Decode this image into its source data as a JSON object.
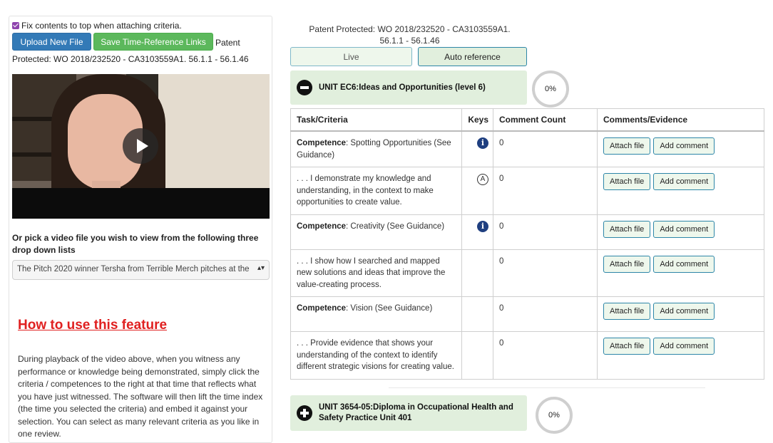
{
  "left": {
    "fix_label": "Fix contents to top when attaching criteria.",
    "upload_label": "Upload New File",
    "save_links_label": "Save Time-Reference Links",
    "patent_inline": "Patent",
    "patent_line2": "Protected: WO 2018/232520 - CA3103559A1. 56.1.1 - 56.1.46",
    "pick_label": "Or pick a video file you wish to view from the following three drop down lists",
    "select_value": "The Pitch 2020 winner Tersha from Terrible Merch pitches at the",
    "how_heading": "How to use this feature",
    "instructions": "During playback of the video above, when you witness any performance or knowledge being demonstrated, simply click the criteria / competences to the right at that time that reflects what you have just witnessed. The software will then lift the time index (the time you selected the criteria) and embed it against your selection. You can select as many relevant criteria as you like in one review."
  },
  "right": {
    "patent_top_line1": "Patent Protected: WO 2018/232520 - CA3103559A1.",
    "patent_top_line2": "56.1.1 - 56.1.46",
    "live_label": "Live",
    "auto_label": "Auto reference",
    "unit1": {
      "title": "UNIT EC6:Ideas and Opportunities (level 6)",
      "progress": "0%"
    },
    "unit2": {
      "title_line1": "UNIT 3654-05:Diploma in Occupational Health and",
      "title_line2": "Safety Practice Unit 401",
      "progress": "0%"
    },
    "table": {
      "headers": {
        "task": "Task/Criteria",
        "keys": "Keys",
        "count": "Comment Count",
        "comments": "Comments/Evidence"
      },
      "attach_label": "Attach file",
      "comment_label": "Add comment",
      "rows": [
        {
          "label": "Competence",
          "text": ": Spotting Opportunities (See Guidance)",
          "key": "i",
          "count": "0"
        },
        {
          "label": "",
          "text": ". . . I demonstrate my knowledge and understanding, in the context to make opportunities to create value.",
          "key": "A",
          "count": "0"
        },
        {
          "label": "Competence",
          "text": ": Creativity (See Guidance)",
          "key": "i",
          "count": "0"
        },
        {
          "label": "",
          "text": ". . . I show how I searched and mapped new solutions and ideas that improve the value-creating process.",
          "key": "",
          "count": "0"
        },
        {
          "label": "Competence",
          "text": ": Vision (See Guidance)",
          "key": "",
          "count": "0"
        },
        {
          "label": "",
          "text": ". . . Provide evidence that shows your understanding of the context to identify different strategic visions for creating value.",
          "key": "",
          "count": "0"
        }
      ]
    }
  },
  "colors": {
    "primary": "#337ab7",
    "success": "#5cb85c",
    "unit_bg": "#e1efdd",
    "heading_red": "#e02020",
    "info_blue": "#1f3f80"
  }
}
